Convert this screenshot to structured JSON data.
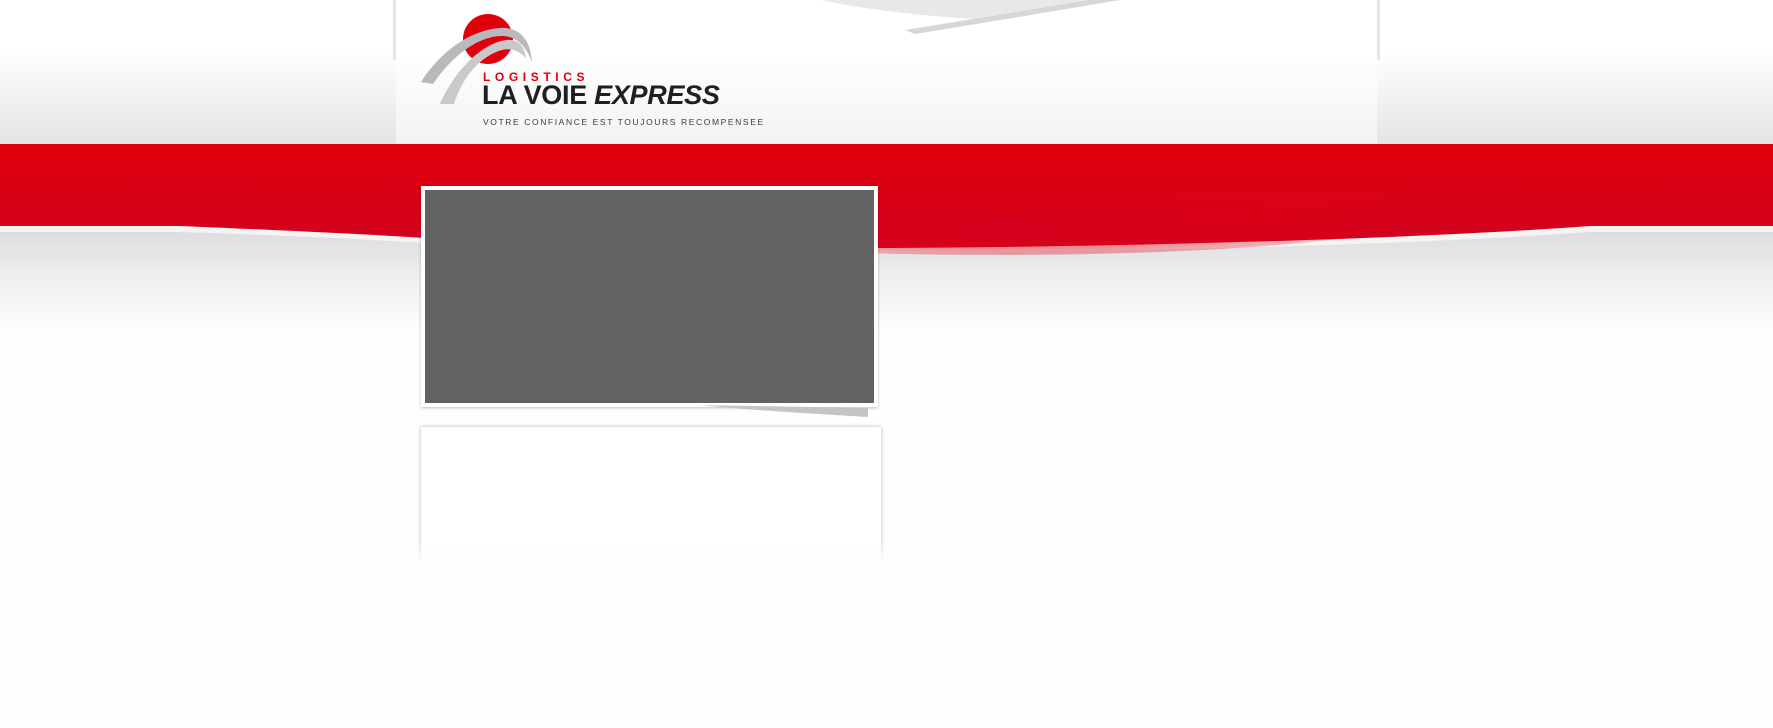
{
  "brand": {
    "top_word": "LOGISTICS",
    "name_part1": "LA VOIE",
    "name_part2": "EXPRESS",
    "tagline": "VOTRE CONFIANCE EST TOUJOURS RECOMPENSEE"
  },
  "colors": {
    "brand_red": "#e0000b",
    "dark_red": "#c8001c",
    "slider_gray": "#626262",
    "text_dark": "#1f1f1f",
    "swoosh_gray": "#b9b9bb"
  },
  "icons": {
    "logo_mark": "red-sun-with-gray-arc-icon"
  }
}
